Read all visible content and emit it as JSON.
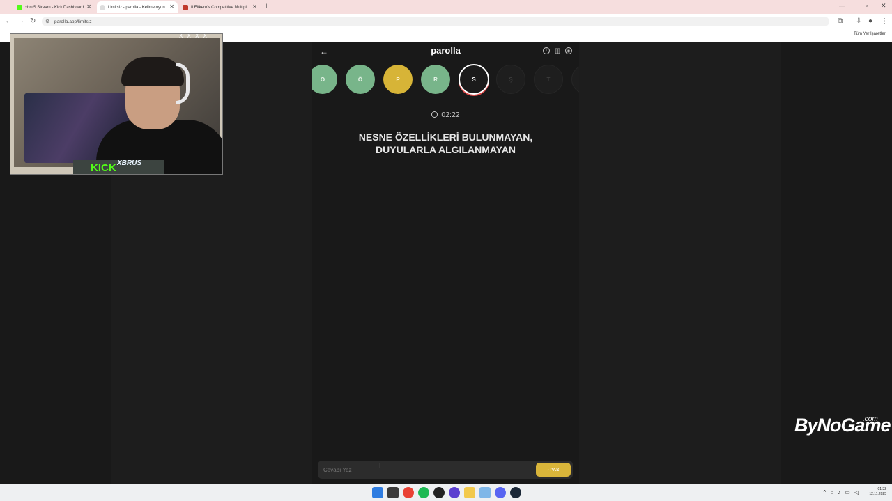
{
  "browser": {
    "tabs": [
      {
        "label": "xbruS Stream - Kick Dashboard",
        "color": "#53fc18"
      },
      {
        "label": "Limitsiz - parolla - Kelime oyun",
        "color": "#e0e0e0"
      },
      {
        "label": "Il Elfkero's Competitive Multipl",
        "color": "#c0392b"
      }
    ],
    "new_tab": "+",
    "url": "parolla.app/limitsiz",
    "bookmarks_all": "Tüm Yer İşaretleri"
  },
  "app": {
    "brand": "parolla",
    "letters": [
      {
        "char": "O",
        "state": "correct"
      },
      {
        "char": "Ö",
        "state": "correct"
      },
      {
        "char": "P",
        "state": "passed"
      },
      {
        "char": "R",
        "state": "correct"
      },
      {
        "char": "S",
        "state": "current"
      },
      {
        "char": "Ş",
        "state": "empty"
      },
      {
        "char": "T",
        "state": "empty"
      }
    ],
    "timer": "02:22",
    "clue": "NESNE ÖZELLİKLERİ BULUNMAYAN, DUYULARLA ALGILANMAYAN",
    "answer_placeholder": "Cevabı Yaz",
    "pass_label": "PAS"
  },
  "webcam": {
    "platform": "KICK",
    "streamer": "XBRUS",
    "corner": "X X X X"
  },
  "watermark": {
    "text": "ByNoGame",
    "suffix": ".com"
  },
  "taskbar": {
    "time": "01:32",
    "date": "12.11.2025"
  },
  "colors": {
    "correct": "#78b58a",
    "passed": "#d7b437",
    "accent": "#d9b53a"
  }
}
